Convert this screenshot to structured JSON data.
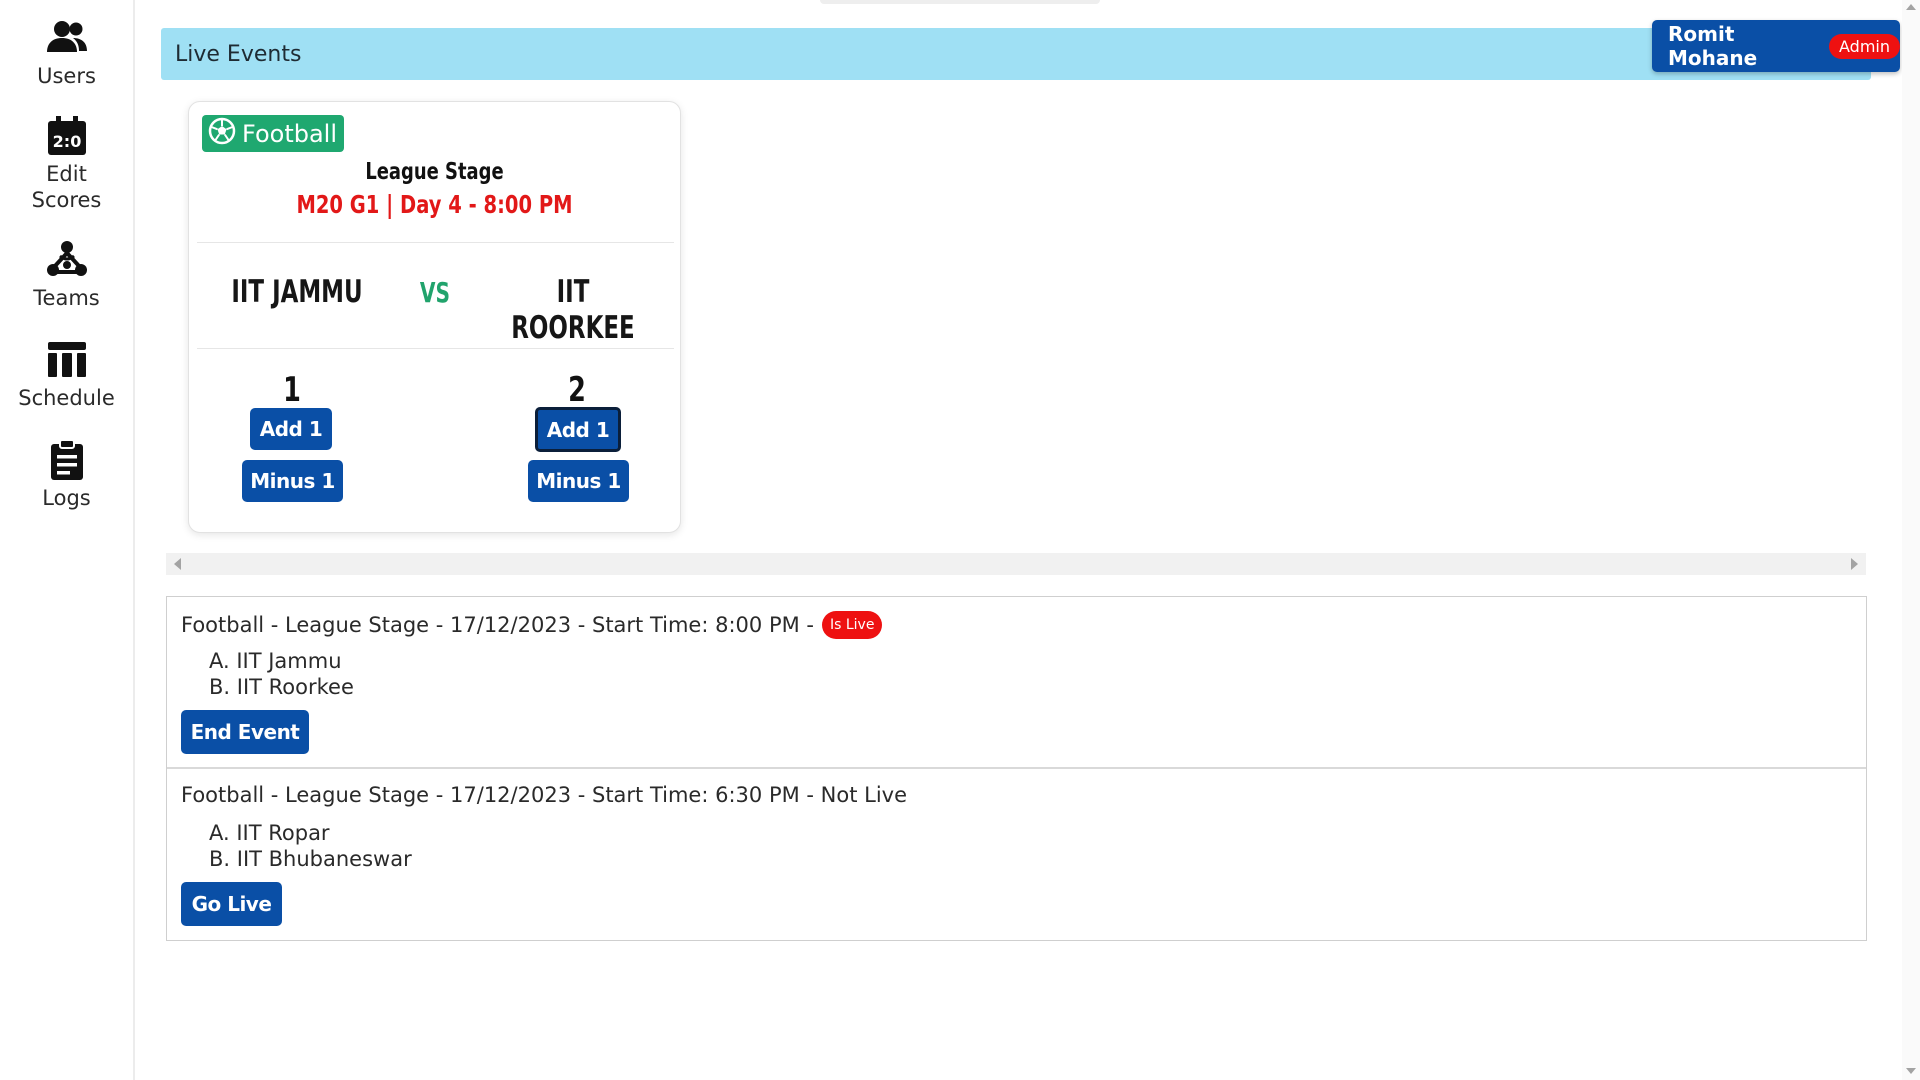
{
  "sidebar": {
    "items": [
      {
        "label": "Users",
        "icon": "users-icon"
      },
      {
        "label": "Edit Scores",
        "icon": "scoreboard-icon"
      },
      {
        "label": "Teams",
        "icon": "teams-icon"
      },
      {
        "label": "Schedule",
        "icon": "schedule-icon"
      },
      {
        "label": "Logs",
        "icon": "clipboard-icon"
      }
    ]
  },
  "header": {
    "title": "Live Events",
    "user_name": "Romit Mohane",
    "role_badge": "Admin"
  },
  "card": {
    "sport": "Football",
    "stage": "League Stage",
    "match_info": "M20 G1 | Day 4 - 8:00 PM",
    "team_a": "IIT JAMMU",
    "vs": "VS",
    "team_b": "IIT ROORKEE",
    "score_a": "1",
    "score_b": "2",
    "add_label": "Add 1",
    "minus_label": "Minus 1"
  },
  "events": [
    {
      "title": "Football - League Stage - 17/12/2023 - Start Time: 8:00 PM -",
      "status_badge": "Is Live",
      "team_a": "A. IIT Jammu",
      "team_b": "B. IIT Roorkee",
      "action_label": "End Event"
    },
    {
      "title": "Football - League Stage - 17/12/2023 - Start Time: 6:30 PM - Not Live",
      "team_a": "A. IIT Ropar",
      "team_b": "B. IIT Bhubaneswar",
      "action_label": "Go Live"
    }
  ],
  "colors": {
    "primary": "#0a4fa6",
    "header_bg": "#9fe0f4",
    "live_red": "#ee1111",
    "sport_green": "#1fa870"
  }
}
